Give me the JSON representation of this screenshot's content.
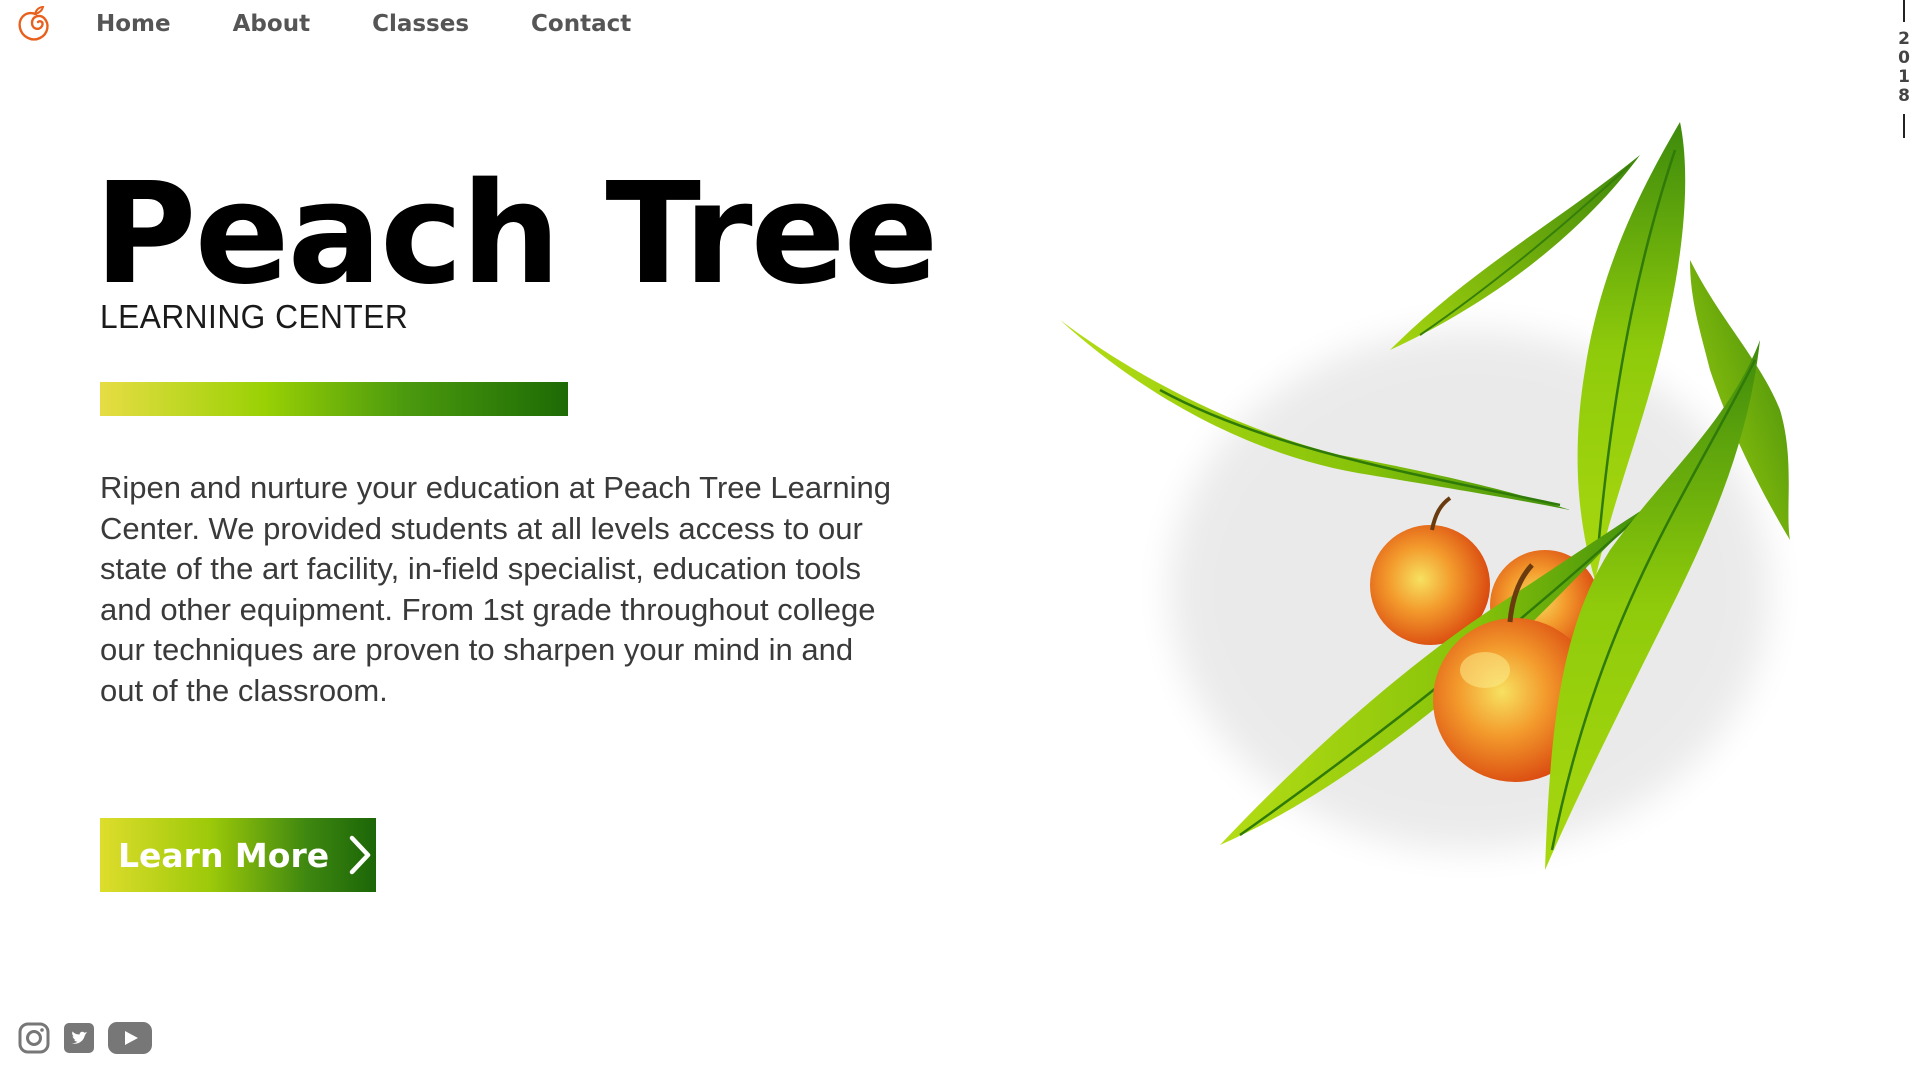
{
  "brand": {
    "logo_icon": "peach-logo-icon",
    "accent_color": "#e8601c"
  },
  "nav": {
    "items": [
      "Home",
      "About",
      "Classes",
      "Contact"
    ]
  },
  "year_badge": "2018",
  "hero": {
    "title": "Peach Tree",
    "subtitle": "LEARNING CENTER",
    "description": "Ripen and nurture your education at Peach Tree Learning Center. We provided students at all levels access to our state of the art facility, in-field specialist, education tools and other equipment. From 1st grade throughout college our techniques are proven to sharpen your mind in and out of the classroom.",
    "cta_label": "Learn More",
    "cta_icon": "chevron-right-icon",
    "gradient_colors": [
      "#e6dd44",
      "#9ad104",
      "#1d6a05"
    ]
  },
  "social": {
    "icons": [
      "instagram-icon",
      "twitter-icon",
      "youtube-icon"
    ],
    "color": "#777777"
  },
  "illustration": {
    "name": "peach-branch-illustration",
    "leaf_color": "#8ccc0a",
    "fruit_color": "#f07020"
  }
}
